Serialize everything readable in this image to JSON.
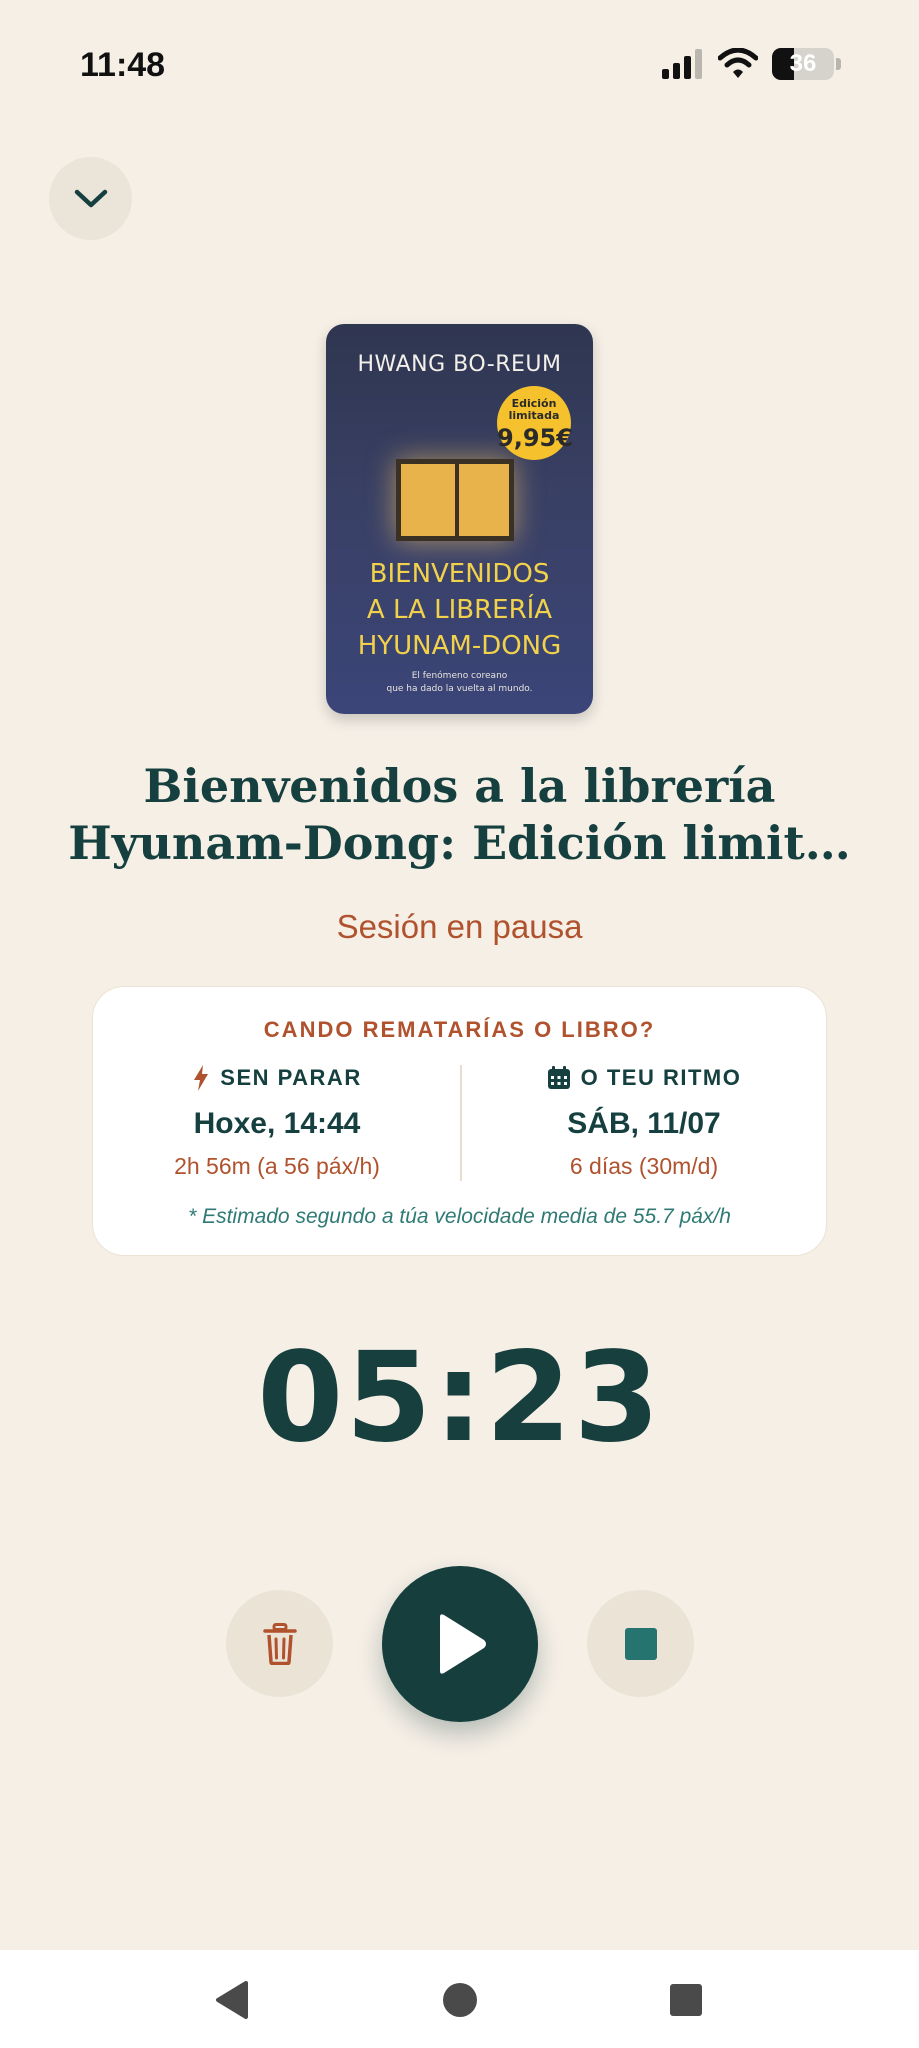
{
  "status_bar": {
    "time": "11:48",
    "battery": "36",
    "battery_level": 0.36
  },
  "book": {
    "cover": {
      "author": "HWANG BO-REUM",
      "badge_line1": "Edición",
      "badge_line2": "limitada",
      "badge_price": "9,95€",
      "title_line1": "BIENVENIDOS",
      "title_line2": "A LA LIBRERÍA",
      "title_line3": "HYUNAM-DONG",
      "tagline_line1": "El fenómeno coreano",
      "tagline_line2": "que ha dado la vuelta al mundo."
    },
    "title": "Bienvenidos a la librería Hyunam-Dong: Edición limit…"
  },
  "session_status": "Sesión en pausa",
  "estimate": {
    "heading": "CANDO REMATARÍAS O LIBRO?",
    "nonstop": {
      "label": "SEN PARAR",
      "value": "Hoxe, 14:44",
      "detail": "2h 56m (a 56 páx/h)",
      "icon": "lightning-icon"
    },
    "pace": {
      "label": "O TEU RITMO",
      "value": "SÁB, 11/07",
      "detail": "6 días (30m/d)",
      "icon": "calendar-icon"
    },
    "note": "* Estimado segundo a túa velocidade media de 55.7 páx/h"
  },
  "timer": "05:23",
  "controls": {
    "delete_icon": "trash-icon",
    "play_icon": "play-icon",
    "stop_icon": "stop-icon"
  },
  "colors": {
    "background": "#f5efe6",
    "primary": "#153e3d",
    "accent": "#b0522d",
    "teal": "#2f7a74"
  }
}
